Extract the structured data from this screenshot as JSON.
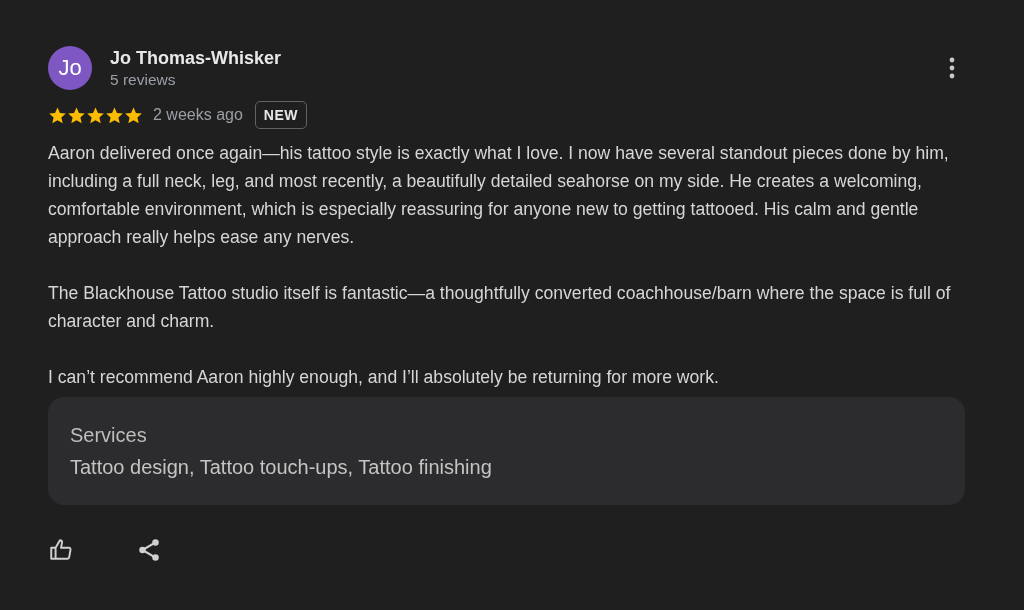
{
  "review": {
    "avatar_initials": "Jo",
    "author": "Jo Thomas-Whisker",
    "author_meta": "5 reviews",
    "stars": 5,
    "time": "2 weeks ago",
    "badge": "NEW",
    "paragraphs": [
      "Aaron delivered once again—his tattoo style is exactly what I love. I now have several standout pieces done by him, including a full neck, leg, and most recently, a beautifully detailed seahorse on my side. He creates a welcoming, comfortable environment, which is especially reassuring for anyone new to getting tattooed. His calm and gentle approach really helps ease any nerves.",
      "The Blackhouse Tattoo studio itself is fantastic—a thoughtfully converted coachhouse/barn where the space is full of character and charm.",
      "I can’t recommend Aaron highly enough, and I’ll absolutely be returning for more work."
    ],
    "services": {
      "title": "Services",
      "text": "Tattoo design, Tattoo touch-ups, Tattoo finishing"
    }
  }
}
